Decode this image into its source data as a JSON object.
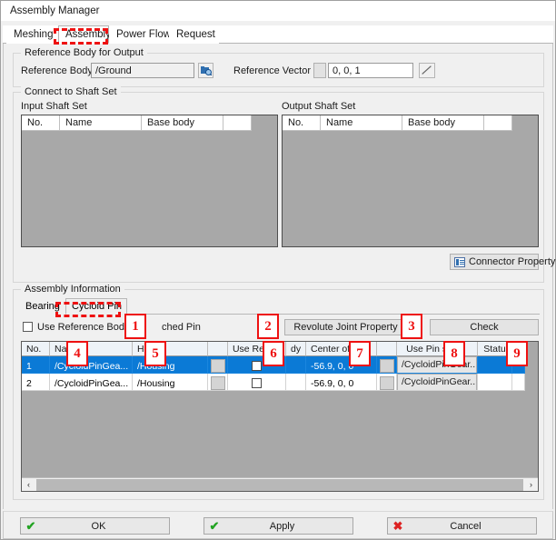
{
  "window": {
    "title": "Assembly Manager"
  },
  "tabs": [
    {
      "label": "Meshing",
      "selected": false
    },
    {
      "label": "Assembly",
      "selected": true
    },
    {
      "label": "Power Flow",
      "selected": false
    },
    {
      "label": "Request",
      "selected": false
    }
  ],
  "reference_body_group": {
    "title": "Reference Body for Output",
    "reference_body_label": "Reference Body",
    "reference_body_value": "/Ground",
    "browse_icon": "browse-body-icon",
    "reference_vector_label": "Reference Vector",
    "reference_vector_value": "0, 0, 1",
    "vector_pick_icon": "vector-pick-icon"
  },
  "connect_group": {
    "title": "Connect to Shaft Set",
    "input_label": "Input Shaft Set",
    "output_label": "Output Shaft Set",
    "columns": [
      "No.",
      "Name",
      "Base body",
      ""
    ],
    "input_rows": [],
    "output_rows": [],
    "connector_property_label": "Connector Property"
  },
  "assembly_group": {
    "title": "Assembly Information",
    "subtabs": [
      {
        "label": "Bearing",
        "selected": false
      },
      {
        "label": "Cycloid Pin",
        "selected": true
      }
    ],
    "use_reference_checkbox": {
      "label_left": "Use Reference Body for",
      "label_right": "ched Pin",
      "checked": false
    },
    "revolute_joint_button": "Revolute Joint Property",
    "check_button": "Check",
    "grid": {
      "columns": [
        "No.",
        "Na",
        "Hou",
        "",
        "Use Refere",
        "dy",
        "Center of",
        "",
        "Use Pin set",
        "",
        "Statu",
        ""
      ],
      "rows": [
        {
          "no": "1",
          "name": "/CycloidPinGea...",
          "housing": "/Housing",
          "pick": "",
          "use_reference_checked": false,
          "center": "-56.9, 0, 0",
          "center_pick": "",
          "use_pin_set": "/CycloidPinGear...",
          "status": "",
          "selected": true
        },
        {
          "no": "2",
          "name": "/CycloidPinGea...",
          "housing": "/Housing",
          "pick": "",
          "use_reference_checked": false,
          "center": "-56.9, 0, 0",
          "center_pick": "",
          "use_pin_set": "/CycloidPinGear...",
          "status": "",
          "selected": false
        }
      ]
    },
    "scrollbar": {
      "left_arrow": "‹",
      "right_arrow": "›"
    }
  },
  "footer": {
    "ok": {
      "label": "OK",
      "glyph": "✔"
    },
    "apply": {
      "label": "Apply",
      "glyph": "✔"
    },
    "cancel": {
      "label": "Cancel",
      "glyph": "✖"
    }
  },
  "annotations": [
    {
      "id": "1",
      "number": "1"
    },
    {
      "id": "2",
      "number": "2"
    },
    {
      "id": "3",
      "number": "3"
    },
    {
      "id": "4",
      "number": "4"
    },
    {
      "id": "5",
      "number": "5"
    },
    {
      "id": "6",
      "number": "6"
    },
    {
      "id": "7",
      "number": "7"
    },
    {
      "id": "8",
      "number": "8"
    },
    {
      "id": "9",
      "number": "9"
    }
  ],
  "colors": {
    "selection_blue": "#0b7ad6",
    "annotation_red": "#ee1111",
    "panel_gray": "#f0f0f0",
    "list_gray": "#a8a8a8"
  }
}
